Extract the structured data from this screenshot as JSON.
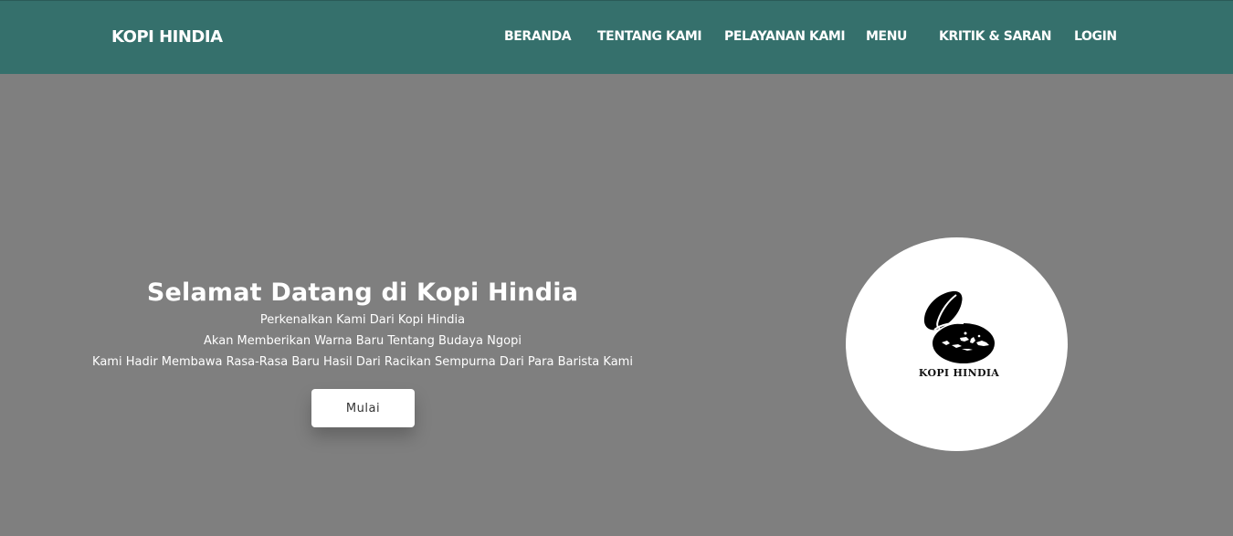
{
  "brand": "KOPI HINDIA",
  "nav": [
    {
      "label": "BERANDA"
    },
    {
      "label": "TENTANG KAMI"
    },
    {
      "label": "PELAYANAN KAMI"
    },
    {
      "label": "MENU"
    },
    {
      "label": "KRITIK & SARAN"
    },
    {
      "label": "LOGIN"
    }
  ],
  "hero": {
    "title": "Selamat Datang di Kopi Hindia",
    "lines": [
      "Perkenalkan Kami Dari Kopi Hindia",
      "Akan Memberikan Warna Baru Tentang Budaya Ngopi",
      "Kami Hadir Membawa Rasa-Rasa Baru Hasil Dari Racikan Sempurna Dari Para Barista Kami"
    ],
    "button_label": "Mulai"
  },
  "logo": {
    "icon": "coffee-bean-indonesia-map-logo",
    "text": "KOPI HINDIA"
  },
  "colors": {
    "navbar": "#35706c",
    "hero_background": "#7f7f7f",
    "text": "#ffffff"
  }
}
